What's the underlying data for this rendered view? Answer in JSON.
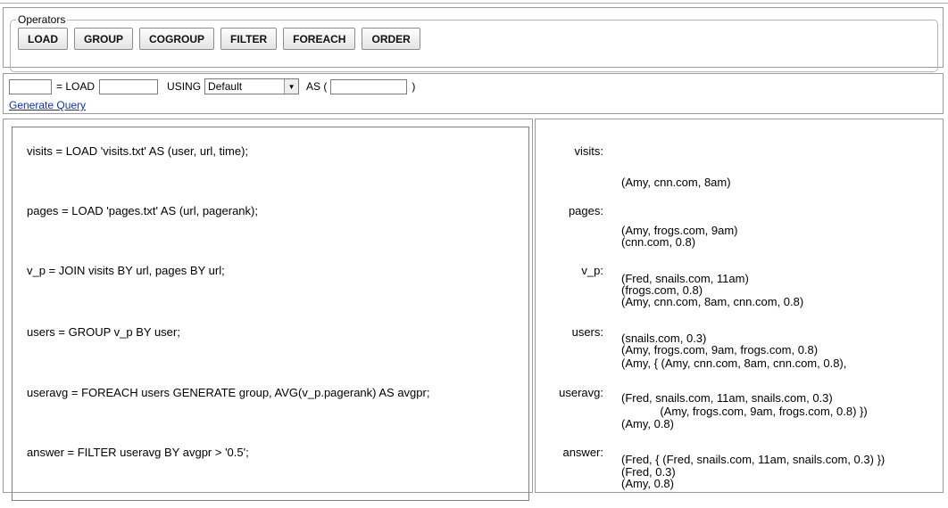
{
  "operators": {
    "legend": "Operators",
    "buttons": [
      "LOAD",
      "GROUP",
      "COGROUP",
      "FILTER",
      "FOREACH",
      "ORDER"
    ]
  },
  "query_builder": {
    "var_value": "",
    "eq_load_label": "= LOAD",
    "file_value": "",
    "using_label": "USING",
    "using_selected": "Default",
    "as_label": "AS (",
    "schema_value": "",
    "close_paren": ")",
    "generate_link": "Generate Query"
  },
  "statements": [
    "visits = LOAD 'visits.txt' AS (user, url, time);",
    "pages = LOAD 'pages.txt' AS (url, pagerank);",
    "v_p = JOIN visits BY url, pages BY url;",
    "users = GROUP v_p BY user;",
    "useravg = FOREACH users GENERATE group, AVG(v_p.pagerank) AS avgpr;",
    "answer = FILTER useravg BY avgpr > '0.5';"
  ],
  "results": [
    {
      "label": "visits:",
      "lines": [
        "(Amy, cnn.com, 8am)",
        "(Amy, frogs.com, 9am)",
        "(Fred, snails.com, 11am)"
      ]
    },
    {
      "label": "pages:",
      "lines": [
        "(cnn.com, 0.8)",
        "(frogs.com, 0.8)",
        "(snails.com, 0.3)"
      ]
    },
    {
      "label": "v_p:",
      "lines": [
        "(Amy, cnn.com, 8am, cnn.com, 0.8)",
        "(Amy, frogs.com, 9am, frogs.com, 0.8)",
        "(Fred, snails.com, 11am, snails.com, 0.3)"
      ]
    },
    {
      "label": "users:",
      "lines": [
        "(Amy, { (Amy, cnn.com, 8am, cnn.com, 0.8),",
        "            (Amy, frogs.com, 9am, frogs.com, 0.8) })",
        "(Fred, { (Fred, snails.com, 11am, snails.com, 0.3) })"
      ]
    },
    {
      "label": "useravg:",
      "lines": [
        "(Amy, 0.8)",
        "(Fred, 0.3)"
      ]
    },
    {
      "label": "answer:",
      "lines": [
        "(Amy, 0.8)"
      ]
    }
  ]
}
